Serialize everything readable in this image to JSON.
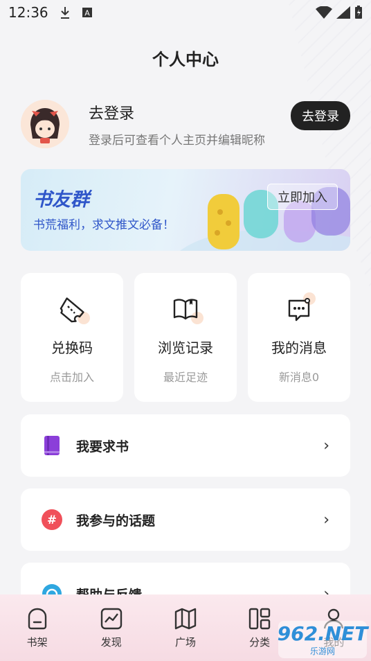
{
  "status": {
    "time": "12:36"
  },
  "header": {
    "title": "个人中心"
  },
  "profile": {
    "name": "去登录",
    "subtitle": "登录后可查看个人主页并编辑昵称",
    "login_button": "去登录"
  },
  "banner": {
    "title": "书友群",
    "subtitle": "书荒福利，求文推文必备！",
    "button": "立即加入"
  },
  "quick": [
    {
      "label": "兑换码",
      "sub": "点击加入",
      "icon": "ticket-icon"
    },
    {
      "label": "浏览记录",
      "sub": "最近足迹",
      "icon": "book-icon"
    },
    {
      "label": "我的消息",
      "sub": "新消息0",
      "icon": "message-icon"
    }
  ],
  "rows": [
    {
      "label": "我要求书",
      "icon": "book-request-icon",
      "color": "#8b3fd9"
    },
    {
      "label": "我参与的话题",
      "icon": "hashtag-icon",
      "color": "#f0505a"
    },
    {
      "label": "帮助与反馈",
      "icon": "help-icon",
      "color": "#2fa7e0"
    }
  ],
  "tabs": [
    {
      "label": "书架",
      "icon": "bookshelf-icon"
    },
    {
      "label": "发现",
      "icon": "trend-icon"
    },
    {
      "label": "广场",
      "icon": "map-icon"
    },
    {
      "label": "分类",
      "icon": "grid-icon"
    },
    {
      "label": "我的",
      "icon": "user-icon"
    }
  ],
  "watermark": {
    "number": "962.NET",
    "text": "乐游网"
  }
}
